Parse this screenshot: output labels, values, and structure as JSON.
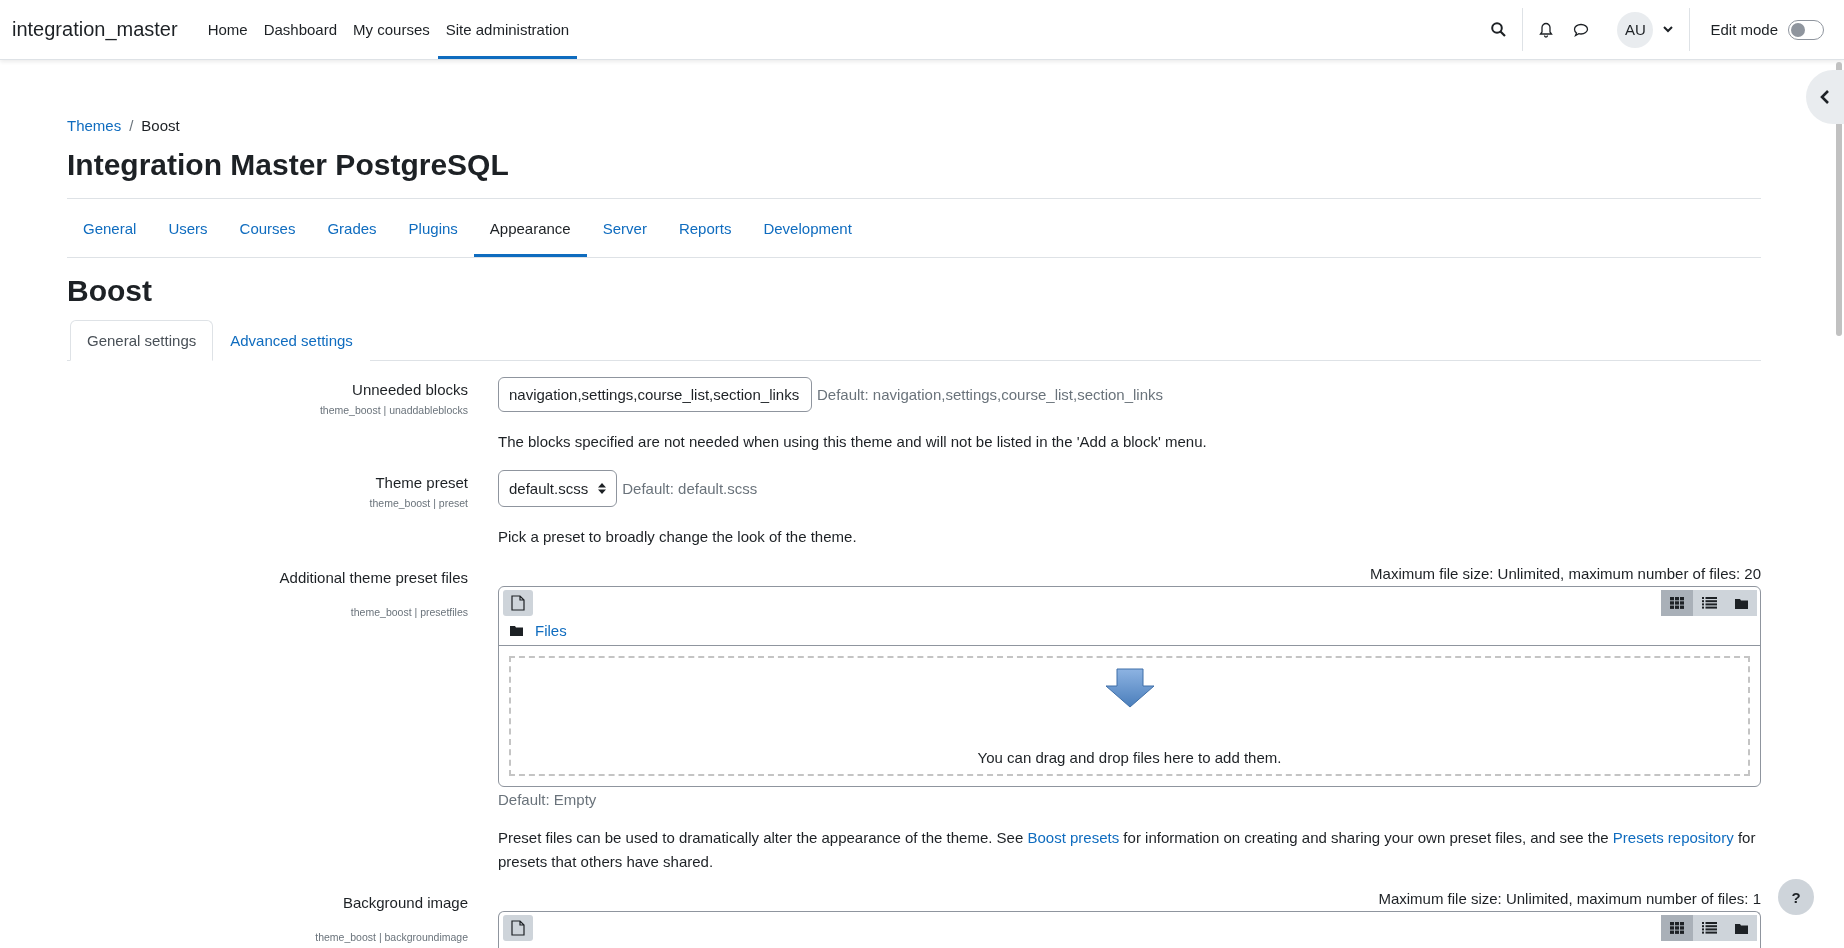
{
  "navbar": {
    "site_name": "integration_master",
    "items": [
      {
        "label": "Home",
        "selected": false
      },
      {
        "label": "Dashboard",
        "selected": false
      },
      {
        "label": "My courses",
        "selected": false
      },
      {
        "label": "Site administration",
        "selected": true
      }
    ],
    "avatar": "AU",
    "edit_mode": {
      "label": "Edit mode",
      "on": false
    }
  },
  "breadcrumb": [
    {
      "label": "Themes",
      "kind": "link"
    },
    {
      "label": "/",
      "kind": "separator"
    },
    {
      "label": "Boost",
      "kind": "current"
    }
  ],
  "page_title": "Integration Master PostgreSQL",
  "admin_tabs": [
    {
      "label": "General",
      "selected": false
    },
    {
      "label": "Users",
      "selected": false
    },
    {
      "label": "Courses",
      "selected": false
    },
    {
      "label": "Grades",
      "selected": false
    },
    {
      "label": "Plugins",
      "selected": false
    },
    {
      "label": "Appearance",
      "selected": true
    },
    {
      "label": "Server",
      "selected": false
    },
    {
      "label": "Reports",
      "selected": false
    },
    {
      "label": "Development",
      "selected": false
    }
  ],
  "section_title": "Boost",
  "settings_tabs": [
    {
      "label": "General settings",
      "selected": true
    },
    {
      "label": "Advanced settings",
      "selected": false
    }
  ],
  "settings": [
    {
      "kind": "text",
      "label": "Unneeded blocks",
      "key": "theme_boost | unaddableblocks",
      "value": "navigation,settings,course_list,section_links",
      "default": "Default: navigation,settings,course_list,section_links",
      "description": [
        {
          "kind": "text",
          "text": "The blocks specified are not needed when using this theme and will not be listed in the 'Add a block' menu."
        }
      ]
    },
    {
      "kind": "select",
      "label": "Theme preset",
      "key": "theme_boost | preset",
      "value": "default.scss",
      "default": "Default: default.scss",
      "description": [
        {
          "kind": "text",
          "text": "Pick a preset to broadly change the look of the theme."
        }
      ]
    },
    {
      "kind": "files",
      "label": "Additional theme preset files",
      "key": "theme_boost | presetfiles",
      "limits": "Maximum file size: Unlimited, maximum number of files: 20",
      "folder": "Files",
      "drop_hint": "You can drag and drop files here to add them.",
      "view_modes": [
        {
          "kind": "grid",
          "selected": true
        },
        {
          "kind": "list",
          "selected": false
        },
        {
          "kind": "tree",
          "selected": false
        }
      ],
      "default": "Default: Empty",
      "description": [
        {
          "kind": "text",
          "text": "Preset files can be used to dramatically alter the appearance of the theme. See "
        },
        {
          "kind": "link",
          "text": "Boost presets"
        },
        {
          "kind": "text",
          "text": " for information on creating and sharing your own preset files, and see the "
        },
        {
          "kind": "link",
          "text": "Presets repository"
        },
        {
          "kind": "text",
          "text": " for presets that others have shared."
        }
      ]
    },
    {
      "kind": "files_partial",
      "label": "Background image",
      "key": "theme_boost | backgroundimage",
      "limits": "Maximum file size: Unlimited, maximum number of files: 1",
      "view_modes": [
        {
          "kind": "grid",
          "selected": true
        },
        {
          "kind": "list",
          "selected": false
        },
        {
          "kind": "tree",
          "selected": false
        }
      ]
    }
  ],
  "help_button": "?"
}
